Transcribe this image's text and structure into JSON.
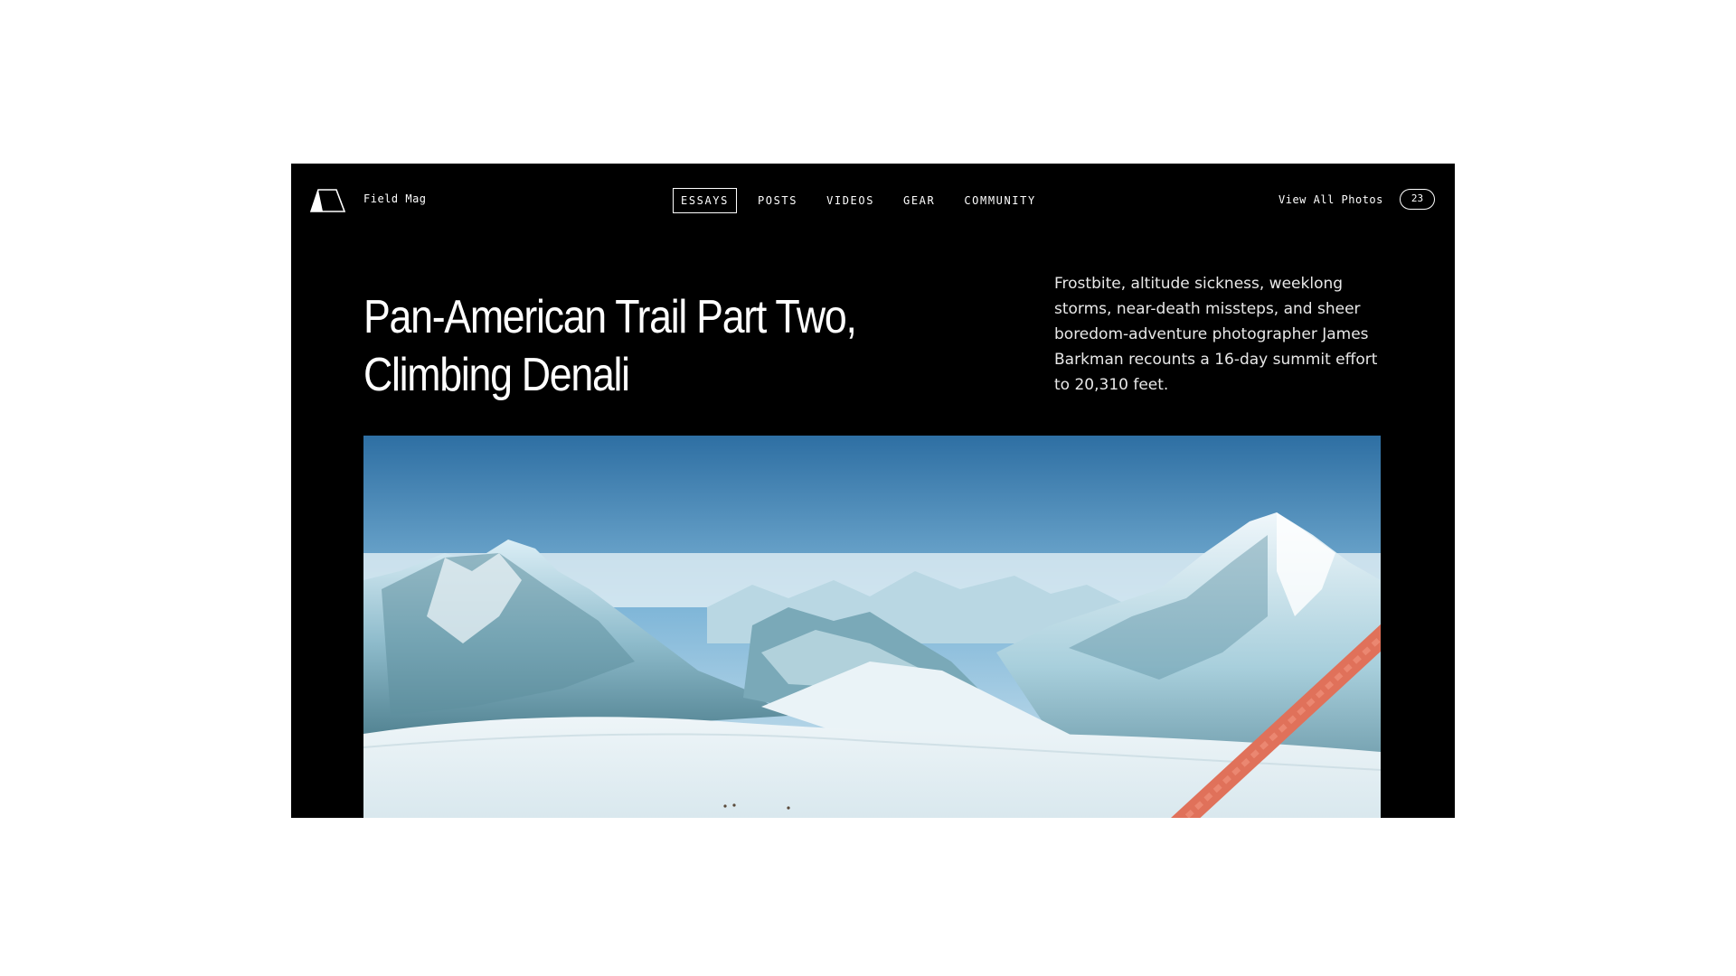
{
  "site": {
    "brand": "Field Mag",
    "logo_icon": "tent-logo-icon"
  },
  "nav": {
    "items": [
      {
        "label": "ESSAYS",
        "active": true
      },
      {
        "label": "POSTS",
        "active": false
      },
      {
        "label": "VIDEOS",
        "active": false
      },
      {
        "label": "GEAR",
        "active": false
      },
      {
        "label": "COMMUNITY",
        "active": false
      }
    ]
  },
  "photos": {
    "link_label": "View All Photos",
    "count": "23"
  },
  "article": {
    "title_line1": "Pan-American Trail Part Two,",
    "title_line2": "Climbing Denali",
    "dek": "Frostbite, altitude sickness, weeklong storms, near-death missteps, and sheer boredom-adventure photographer James Barkman recounts a 16-day summit effort to 20,310 feet."
  },
  "colors": {
    "background": "#000000",
    "page": "#ffffff",
    "text": "#ffffff",
    "rope": "#e0715a"
  }
}
